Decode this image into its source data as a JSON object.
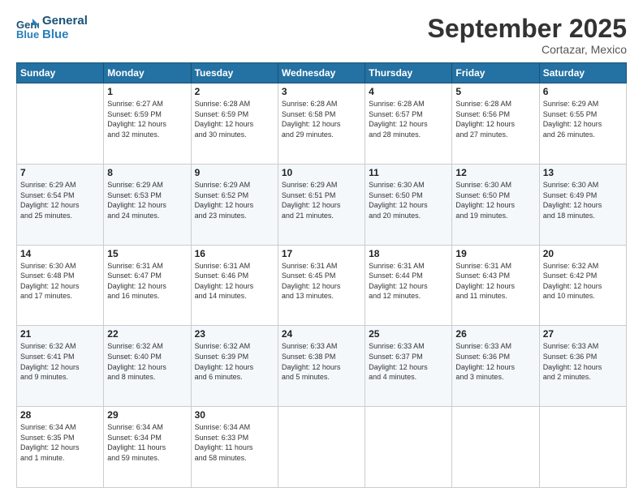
{
  "logo": {
    "line1": "General",
    "line2": "Blue"
  },
  "title": "September 2025",
  "subtitle": "Cortazar, Mexico",
  "days_of_week": [
    "Sunday",
    "Monday",
    "Tuesday",
    "Wednesday",
    "Thursday",
    "Friday",
    "Saturday"
  ],
  "weeks": [
    [
      {
        "day": "",
        "info": ""
      },
      {
        "day": "1",
        "info": "Sunrise: 6:27 AM\nSunset: 6:59 PM\nDaylight: 12 hours\nand 32 minutes."
      },
      {
        "day": "2",
        "info": "Sunrise: 6:28 AM\nSunset: 6:59 PM\nDaylight: 12 hours\nand 30 minutes."
      },
      {
        "day": "3",
        "info": "Sunrise: 6:28 AM\nSunset: 6:58 PM\nDaylight: 12 hours\nand 29 minutes."
      },
      {
        "day": "4",
        "info": "Sunrise: 6:28 AM\nSunset: 6:57 PM\nDaylight: 12 hours\nand 28 minutes."
      },
      {
        "day": "5",
        "info": "Sunrise: 6:28 AM\nSunset: 6:56 PM\nDaylight: 12 hours\nand 27 minutes."
      },
      {
        "day": "6",
        "info": "Sunrise: 6:29 AM\nSunset: 6:55 PM\nDaylight: 12 hours\nand 26 minutes."
      }
    ],
    [
      {
        "day": "7",
        "info": "Sunrise: 6:29 AM\nSunset: 6:54 PM\nDaylight: 12 hours\nand 25 minutes."
      },
      {
        "day": "8",
        "info": "Sunrise: 6:29 AM\nSunset: 6:53 PM\nDaylight: 12 hours\nand 24 minutes."
      },
      {
        "day": "9",
        "info": "Sunrise: 6:29 AM\nSunset: 6:52 PM\nDaylight: 12 hours\nand 23 minutes."
      },
      {
        "day": "10",
        "info": "Sunrise: 6:29 AM\nSunset: 6:51 PM\nDaylight: 12 hours\nand 21 minutes."
      },
      {
        "day": "11",
        "info": "Sunrise: 6:30 AM\nSunset: 6:50 PM\nDaylight: 12 hours\nand 20 minutes."
      },
      {
        "day": "12",
        "info": "Sunrise: 6:30 AM\nSunset: 6:50 PM\nDaylight: 12 hours\nand 19 minutes."
      },
      {
        "day": "13",
        "info": "Sunrise: 6:30 AM\nSunset: 6:49 PM\nDaylight: 12 hours\nand 18 minutes."
      }
    ],
    [
      {
        "day": "14",
        "info": "Sunrise: 6:30 AM\nSunset: 6:48 PM\nDaylight: 12 hours\nand 17 minutes."
      },
      {
        "day": "15",
        "info": "Sunrise: 6:31 AM\nSunset: 6:47 PM\nDaylight: 12 hours\nand 16 minutes."
      },
      {
        "day": "16",
        "info": "Sunrise: 6:31 AM\nSunset: 6:46 PM\nDaylight: 12 hours\nand 14 minutes."
      },
      {
        "day": "17",
        "info": "Sunrise: 6:31 AM\nSunset: 6:45 PM\nDaylight: 12 hours\nand 13 minutes."
      },
      {
        "day": "18",
        "info": "Sunrise: 6:31 AM\nSunset: 6:44 PM\nDaylight: 12 hours\nand 12 minutes."
      },
      {
        "day": "19",
        "info": "Sunrise: 6:31 AM\nSunset: 6:43 PM\nDaylight: 12 hours\nand 11 minutes."
      },
      {
        "day": "20",
        "info": "Sunrise: 6:32 AM\nSunset: 6:42 PM\nDaylight: 12 hours\nand 10 minutes."
      }
    ],
    [
      {
        "day": "21",
        "info": "Sunrise: 6:32 AM\nSunset: 6:41 PM\nDaylight: 12 hours\nand 9 minutes."
      },
      {
        "day": "22",
        "info": "Sunrise: 6:32 AM\nSunset: 6:40 PM\nDaylight: 12 hours\nand 8 minutes."
      },
      {
        "day": "23",
        "info": "Sunrise: 6:32 AM\nSunset: 6:39 PM\nDaylight: 12 hours\nand 6 minutes."
      },
      {
        "day": "24",
        "info": "Sunrise: 6:33 AM\nSunset: 6:38 PM\nDaylight: 12 hours\nand 5 minutes."
      },
      {
        "day": "25",
        "info": "Sunrise: 6:33 AM\nSunset: 6:37 PM\nDaylight: 12 hours\nand 4 minutes."
      },
      {
        "day": "26",
        "info": "Sunrise: 6:33 AM\nSunset: 6:36 PM\nDaylight: 12 hours\nand 3 minutes."
      },
      {
        "day": "27",
        "info": "Sunrise: 6:33 AM\nSunset: 6:36 PM\nDaylight: 12 hours\nand 2 minutes."
      }
    ],
    [
      {
        "day": "28",
        "info": "Sunrise: 6:34 AM\nSunset: 6:35 PM\nDaylight: 12 hours\nand 1 minute."
      },
      {
        "day": "29",
        "info": "Sunrise: 6:34 AM\nSunset: 6:34 PM\nDaylight: 11 hours\nand 59 minutes."
      },
      {
        "day": "30",
        "info": "Sunrise: 6:34 AM\nSunset: 6:33 PM\nDaylight: 11 hours\nand 58 minutes."
      },
      {
        "day": "",
        "info": ""
      },
      {
        "day": "",
        "info": ""
      },
      {
        "day": "",
        "info": ""
      },
      {
        "day": "",
        "info": ""
      }
    ]
  ]
}
